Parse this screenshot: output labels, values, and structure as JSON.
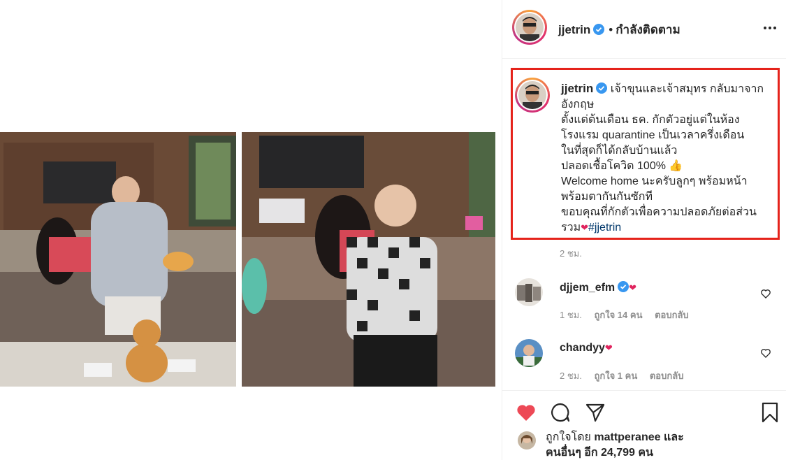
{
  "post": {
    "username": "jjetrin",
    "follow_status": "กำลังติดตาม",
    "separator": "•"
  },
  "caption": {
    "username": "jjetrin",
    "lines": [
      "เจ้าขุนและเจ้าสมุทร กลับมาจาก",
      "อังกฤษ",
      "ตั้งแต่ต้นเดือน ธค. กักตัวอยู่แต่ในห้อง",
      "โรงแรม quarantine เป็นเวลาครึ่งเดือน",
      "ในที่สุดก็ได้กลับบ้านแล้ว",
      "ปลอดเชื้อโควิด 100% 👍",
      "Welcome home นะครับลูกๆ พร้อมหน้า",
      "พร้อมตากันกันซักที",
      "ขอบคุณที่กักตัวเพื่อความปลอดภัยต่อส่วน"
    ],
    "last_line_prefix": "รวม",
    "hashtag": "#jjetrin",
    "time": "2 ชม."
  },
  "comments": [
    {
      "username": "djjem_efm",
      "time": "1 ชม.",
      "likes": "ถูกใจ 14 คน",
      "reply": "ตอบกลับ"
    },
    {
      "username": "chandyy",
      "time": "2 ชม.",
      "likes": "ถูกใจ 1 คน",
      "reply": "ตอบกลับ"
    }
  ],
  "likes": {
    "prefix": "ถูกใจโดย",
    "user": "mattperanee",
    "and": "และ",
    "others": "คนอื่นๆ อีก 24,799 คน"
  },
  "icons": {
    "heart": "heart-filled-icon",
    "comment": "comment-icon",
    "share": "share-icon",
    "save": "bookmark-icon",
    "more": "more-icon",
    "verified": "verified-badge-icon"
  },
  "colors": {
    "heart_red": "#ed4956",
    "verified_blue": "#3897f0",
    "highlight_box": "#e5231b",
    "hashtag": "#00376b",
    "muted": "#8e8e8e"
  }
}
